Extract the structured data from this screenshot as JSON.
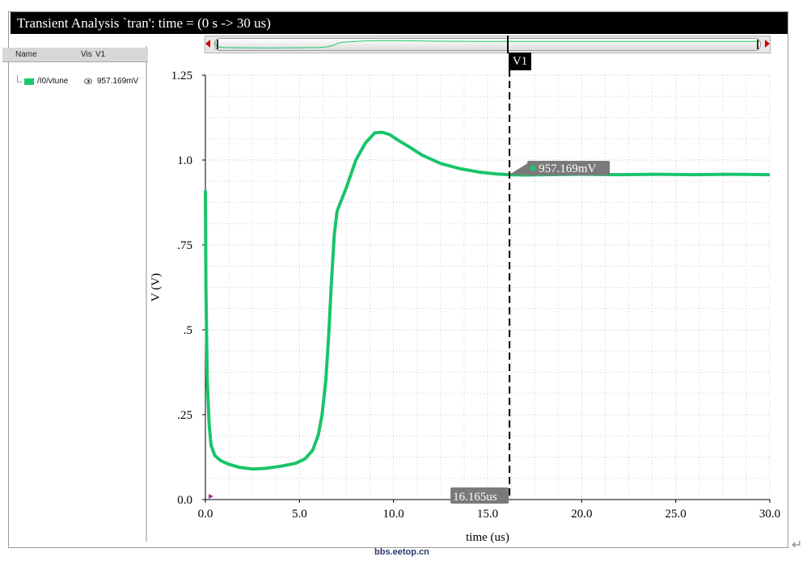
{
  "window": {
    "title": "Transient Analysis `tran': time = (0 s -> 30 us)"
  },
  "signal_panel": {
    "columns": [
      "Name",
      "Vis",
      "V1"
    ],
    "signals": [
      {
        "name": "/I0/vtune",
        "color": "#1ec86e",
        "visible_icon": "eye-icon",
        "value": "957.169mV"
      }
    ]
  },
  "cursor": {
    "label": "V1",
    "x_readout": "16.165us",
    "y_readout": "957.169mV"
  },
  "watermark": "bbs.eetop.cn",
  "chart_data": {
    "type": "line",
    "xlabel": "time (us)",
    "ylabel": "V (V)",
    "xlim": [
      0,
      30
    ],
    "ylim": [
      0,
      1.25
    ],
    "x_ticks": [
      0,
      5,
      10,
      15,
      20,
      25,
      30
    ],
    "x_tick_labels": [
      "0.0",
      "5.0",
      "10.0",
      "15.0",
      "20.0",
      "25.0",
      "30.0"
    ],
    "y_ticks": [
      0,
      0.25,
      0.5,
      0.75,
      1.0,
      1.25
    ],
    "y_tick_labels": [
      "0.0",
      ".25",
      ".5",
      ".75",
      "1.0",
      "1.25"
    ],
    "grid": true,
    "cursor_x": 16.165,
    "cursor_y": 0.957169,
    "series": [
      {
        "name": "/I0/vtune",
        "color": "#1ec86e",
        "x": [
          0.0,
          0.03,
          0.1,
          0.2,
          0.3,
          0.5,
          0.8,
          1.2,
          1.8,
          2.5,
          3.2,
          4.0,
          4.8,
          5.3,
          5.7,
          6.0,
          6.2,
          6.4,
          6.55,
          6.7,
          6.85,
          7.0,
          7.5,
          8.0,
          8.5,
          9.0,
          9.4,
          9.8,
          10.2,
          10.8,
          11.5,
          12.5,
          13.5,
          14.5,
          15.5,
          16.165,
          17.0,
          18.0,
          20.0,
          22.0,
          24.0,
          26.0,
          28.0,
          30.0
        ],
        "y": [
          0.91,
          0.62,
          0.35,
          0.22,
          0.16,
          0.13,
          0.115,
          0.105,
          0.095,
          0.09,
          0.092,
          0.098,
          0.107,
          0.12,
          0.145,
          0.19,
          0.25,
          0.35,
          0.48,
          0.64,
          0.78,
          0.85,
          0.92,
          1.0,
          1.05,
          1.08,
          1.082,
          1.075,
          1.06,
          1.04,
          1.015,
          0.99,
          0.975,
          0.965,
          0.959,
          0.957,
          0.956,
          0.957,
          0.958,
          0.957,
          0.958,
          0.957,
          0.958,
          0.957
        ]
      }
    ]
  }
}
